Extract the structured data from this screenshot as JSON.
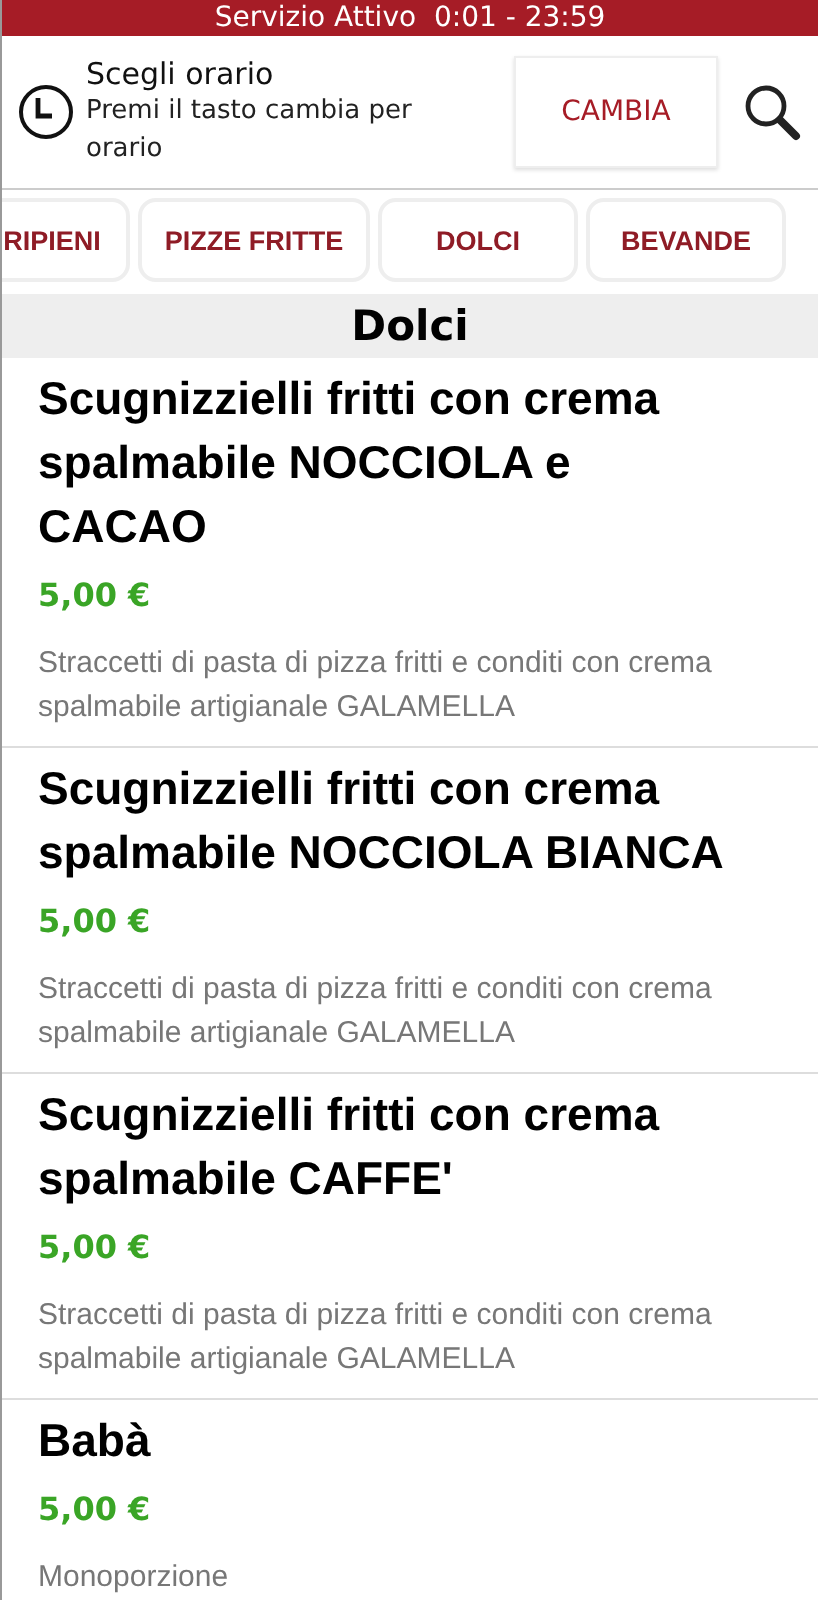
{
  "status_bar": {
    "text": "Servizio Attivo  0:01 - 23:59"
  },
  "time_picker": {
    "title": "Scegli orario",
    "hint": "Premi il tasto cambia per orario",
    "button": "CAMBIA"
  },
  "tabs": [
    {
      "label": "RIPIENI"
    },
    {
      "label": "PIZZE FRITTE"
    },
    {
      "label": "DOLCI"
    },
    {
      "label": "BEVANDE"
    }
  ],
  "section": {
    "title": "Dolci"
  },
  "items": [
    {
      "name": "Scugnizzielli fritti con crema spalmabile NOCCIOLA e CACAO",
      "price": "5,00 €",
      "description": "Straccetti di pasta di pizza fritti e conditi con crema spalmabile artigianale GALAMELLA"
    },
    {
      "name": "Scugnizzielli fritti con crema spalmabile NOCCIOLA BIANCA",
      "price": "5,00 €",
      "description": "Straccetti di pasta di pizza fritti e conditi con crema spalmabile artigianale GALAMELLA"
    },
    {
      "name": "Scugnizzielli fritti con crema spalmabile CAFFE'",
      "price": "5,00 €",
      "description": "Straccetti di pasta di pizza fritti e conditi con crema spalmabile artigianale GALAMELLA"
    },
    {
      "name": "Babà",
      "price": "5,00 €",
      "description": "Monoporzione"
    }
  ]
}
